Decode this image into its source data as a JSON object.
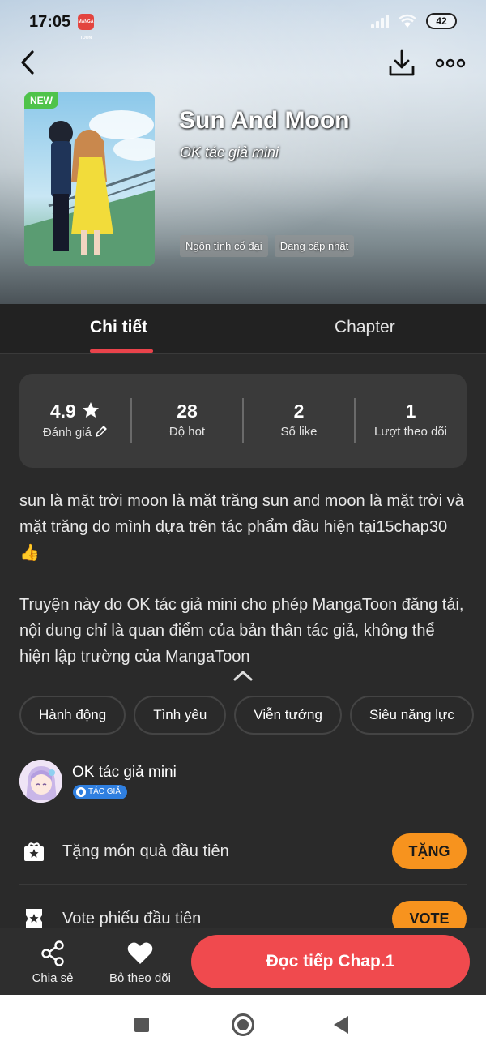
{
  "status_bar": {
    "time": "17:05",
    "app_icon_label": "MANGA TOON",
    "battery": "42",
    "icons": [
      "signal-icon",
      "wifi-icon",
      "battery-icon"
    ]
  },
  "header": {
    "badge": "NEW",
    "title": "Sun And Moon",
    "author": "OK tác giả mini",
    "tags": [
      "Ngôn tình cổ đại",
      "Đang cập nhật"
    ],
    "icons": [
      "back-arrow-icon",
      "download-icon",
      "more-dots-icon"
    ]
  },
  "tabs": [
    {
      "label": "Chi tiết",
      "active": true
    },
    {
      "label": "Chapter",
      "active": false
    }
  ],
  "stats": [
    {
      "value": "4.9",
      "label": "Đánh giá",
      "value_icon": "star-icon",
      "label_icon": "pencil-icon"
    },
    {
      "value": "28",
      "label": "Độ hot"
    },
    {
      "value": "2",
      "label": "Số like"
    },
    {
      "value": "1",
      "label": "Lượt theo dõi"
    }
  ],
  "description": {
    "paragraph1": "sun là mặt trời moon là mặt trăng sun and moon là mặt trời và mặt trăng do mình dựa trên tác phẩm đầu hiện tại15chap30👍",
    "paragraph2": "Truyện này do OK tác giả mini cho phép MangaToon đăng tải, nội dung chỉ là quan điểm của bản thân tác giả, không thể hiện lập trường của MangaToon"
  },
  "categories": [
    "Hành động",
    "Tình yêu",
    "Viễn tưởng",
    "Siêu năng lực"
  ],
  "author": {
    "name": "OK tác giả mini",
    "badge": "TÁC GIẢ"
  },
  "actions": {
    "gift": {
      "label": "Tặng món quà đầu tiên",
      "button": "TẶNG"
    },
    "vote": {
      "label": "Vote phiếu đầu tiên",
      "button": "VOTE"
    }
  },
  "bottom_bar": {
    "share_label": "Chia sẻ",
    "follow_label": "Bỏ theo dõi",
    "read_label": "Đọc tiếp Chap.1"
  },
  "colors": {
    "accent_red": "#f04a4e",
    "tab_underline": "#e9434b",
    "orange_button": "#f7931e",
    "new_badge": "#4fc34a",
    "author_badge": "#2f7fe0",
    "background": "#2a2a2a"
  }
}
